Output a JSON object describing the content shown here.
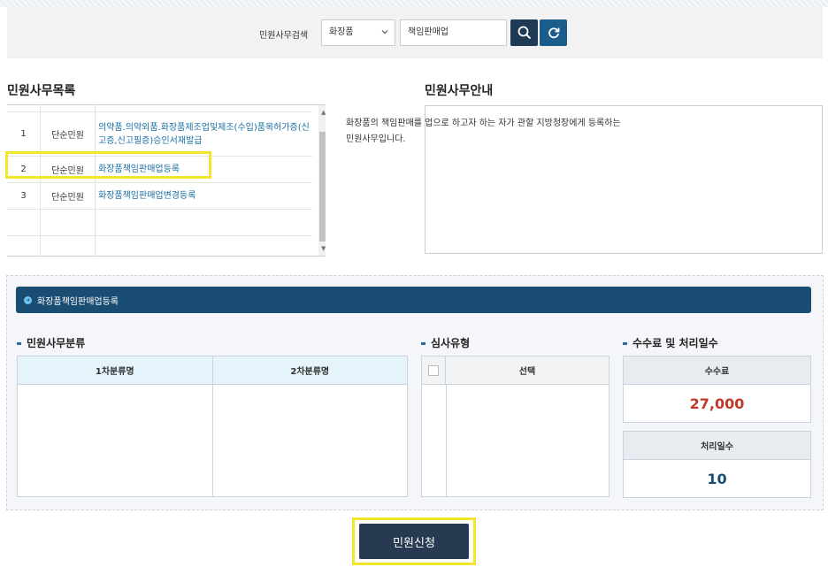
{
  "search": {
    "label": "민원사무검색",
    "category_value": "화장품",
    "query_value": "책임판매업"
  },
  "list_section": {
    "title": "민원사무목록",
    "rows": [
      {
        "no": "1",
        "type": "단순민원",
        "name": "의약품.의약외품.화장품제조업및제조(수입)품목허가증(신고증,신고필증)승인서재발급"
      },
      {
        "no": "2",
        "type": "단순민원",
        "name": "화장품책임판매업등록"
      },
      {
        "no": "3",
        "type": "단순민원",
        "name": "화장품책임판매업변경등록"
      }
    ]
  },
  "guide_section": {
    "title": "민원사무안내",
    "line1": "화장품의 책임판매를 업으로 하고자 하는 자가 관할 지방청장에게 등록하는",
    "line2": "민원사무입니다."
  },
  "detail": {
    "header": "화장품책임판매업등록",
    "classification": {
      "title": "민원사무분류",
      "col1": "1차분류명",
      "col2": "2차분류명"
    },
    "review": {
      "title": "심사유형",
      "col": "선택"
    },
    "fee": {
      "title": "수수료 및 처리일수",
      "fee_label": "수수료",
      "fee_value": "27,000",
      "days_label": "처리일수",
      "days_value": "10"
    }
  },
  "apply_button": "민원신청",
  "colors": {
    "fee_value": "#c0392b",
    "days_value": "#1a4d73",
    "highlight": "#f2e62a"
  }
}
